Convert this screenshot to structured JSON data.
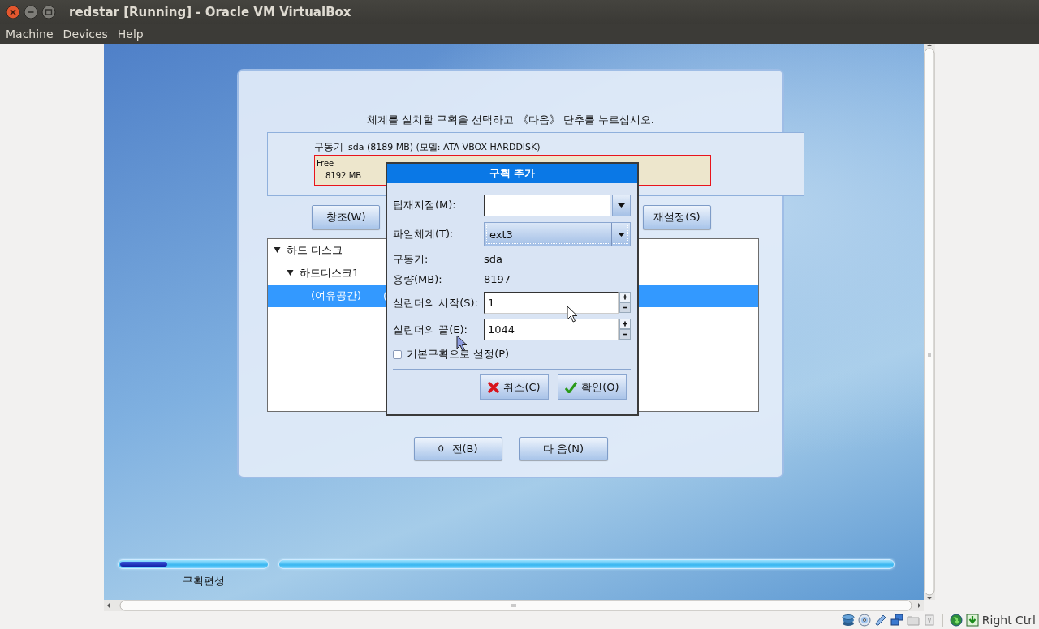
{
  "window": {
    "title": "redstar [Running] - Oracle VM VirtualBox"
  },
  "menu": [
    "Machine",
    "Devices",
    "Help"
  ],
  "installer": {
    "instruction": "체계를 설치할 구획을 선택하고 《다음》 단추를 누르십시오.",
    "drive": {
      "label": "구동기",
      "info": "sda (8189 MB) (모델: ATA VBOX HARDDISK)",
      "segment": {
        "name": "Free",
        "size": "8192 MB"
      }
    },
    "buttons": [
      "창조(W)",
      "재설정(S)"
    ],
    "tree": [
      {
        "label": "하드 디스크",
        "expanded": true,
        "selected": false,
        "children": [
          {
            "label": "하드디스크1",
            "expanded": true,
            "selected": false,
            "children": [
              {
                "label": "(여유공간)",
                "column_2": "(",
                "selected": true
              }
            ]
          }
        ]
      }
    ],
    "nav": [
      "이 전(B)",
      "다 음(N)"
    ]
  },
  "dialog": {
    "title": "구획 추가",
    "fields": [
      {
        "kind": "combo",
        "label": "탑재지점(M):"
      },
      {
        "kind": "select",
        "label": "파일체계(T):",
        "value": "ext3"
      },
      {
        "kind": "info",
        "label": "구동기:",
        "value": "sda"
      },
      {
        "kind": "info",
        "label": "용량(MB):",
        "value": "8197"
      },
      {
        "kind": "spin",
        "label": "실린더의 시작(S):",
        "value": "1"
      },
      {
        "kind": "spin",
        "label": "실린더의 끝(E):",
        "value": "1044"
      }
    ],
    "checkbox": {
      "label": "기본구획으로 설정(P)",
      "checked": false
    },
    "buttons": [
      {
        "kind": "cancel",
        "label": "취소(C)"
      },
      {
        "kind": "ok",
        "label": "확인(O)"
      }
    ]
  },
  "progress": {
    "label": "구획편성",
    "level": 0.32
  },
  "status_bar": {
    "host_key": "Right Ctrl"
  }
}
